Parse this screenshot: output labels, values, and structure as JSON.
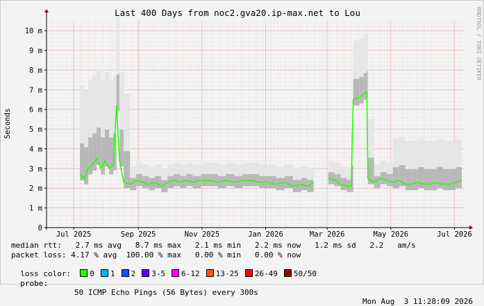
{
  "chart_data": {
    "type": "line",
    "title": "Last 400 Days from noc2.gva20.ip-max.net to Lou",
    "ylabel": "Seconds",
    "watermark": "RRDTOOL / TOBI OETIKER",
    "ylim": [
      0,
      0.0105
    ],
    "y_ticks": [
      "0",
      "1 m",
      "2 m",
      "3 m",
      "4 m",
      "5 m",
      "6 m",
      "7 m",
      "8 m",
      "9 m",
      "10 m"
    ],
    "y_tick_values": [
      0,
      0.001,
      0.002,
      0.003,
      0.004,
      0.005,
      0.006,
      0.007,
      0.008,
      0.009,
      0.01
    ],
    "x_ticks": [
      "Jul 2025",
      "Sep 2025",
      "Nov 2025",
      "Jan 2026",
      "Mar 2026",
      "May 2026",
      "Jul 2026"
    ],
    "x_tick_day": [
      26,
      88,
      149,
      210,
      269,
      330,
      391
    ],
    "xlim_days": [
      0,
      400
    ],
    "grid": true,
    "series": [
      {
        "name": "median rtt",
        "points": [
          [
            32,
            0.0027
          ],
          [
            36,
            0.0025
          ],
          [
            40,
            0.003
          ],
          [
            44,
            0.0032
          ],
          [
            48,
            0.0035
          ],
          [
            52,
            0.003
          ],
          [
            56,
            0.0034
          ],
          [
            60,
            0.003
          ],
          [
            64,
            0.0032
          ],
          [
            67,
            0.0062
          ],
          [
            70,
            0.0034
          ],
          [
            74,
            0.0023
          ],
          [
            80,
            0.0022
          ],
          [
            86,
            0.0024
          ],
          [
            92,
            0.0023
          ],
          [
            98,
            0.0022
          ],
          [
            104,
            0.0023
          ],
          [
            110,
            0.0021
          ],
          [
            116,
            0.0023
          ],
          [
            122,
            0.0024
          ],
          [
            128,
            0.0023
          ],
          [
            134,
            0.0024
          ],
          [
            140,
            0.0023
          ],
          [
            148,
            0.0024
          ],
          [
            156,
            0.0024
          ],
          [
            164,
            0.0023
          ],
          [
            172,
            0.0024
          ],
          [
            180,
            0.0023
          ],
          [
            188,
            0.0024
          ],
          [
            196,
            0.0024
          ],
          [
            204,
            0.0023
          ],
          [
            212,
            0.0023
          ],
          [
            220,
            0.0022
          ],
          [
            228,
            0.0023
          ],
          [
            236,
            0.0021
          ],
          [
            244,
            0.0022
          ],
          [
            250,
            0.0021
          ],
          [
            256,
            0.0023
          ]
        ]
      },
      {
        "name": "median rtt (after gap)",
        "points": [
          [
            270,
            0.0025
          ],
          [
            276,
            0.0024
          ],
          [
            282,
            0.0022
          ],
          [
            288,
            0.0021
          ],
          [
            292,
            0.0021
          ],
          [
            294,
            0.0065
          ],
          [
            300,
            0.0066
          ],
          [
            304,
            0.0068
          ],
          [
            307,
            0.0069
          ],
          [
            308,
            0.0025
          ],
          [
            314,
            0.0023
          ],
          [
            320,
            0.0025
          ],
          [
            326,
            0.0024
          ],
          [
            332,
            0.0023
          ],
          [
            338,
            0.0024
          ],
          [
            344,
            0.0022
          ],
          [
            350,
            0.0022
          ],
          [
            356,
            0.0023
          ],
          [
            362,
            0.0022
          ],
          [
            368,
            0.0022
          ],
          [
            374,
            0.0023
          ],
          [
            380,
            0.0022
          ],
          [
            386,
            0.0022
          ],
          [
            392,
            0.0023
          ],
          [
            398,
            0.0024
          ]
        ]
      }
    ]
  },
  "stats": {
    "median_rtt": "median rtt:   2.7 ms avg   8.7 ms max   2.1 ms min   2.2 ms now   1.2 ms sd   2.2   am/s",
    "packet_loss": "packet loss: 4.17 % avg  100.00 % max   0.00 % min   0.00 % now"
  },
  "loss_color": {
    "label": "loss color:",
    "items": [
      {
        "label": "0",
        "color": "#26ff00"
      },
      {
        "label": "1",
        "color": "#00b8ff"
      },
      {
        "label": "2",
        "color": "#0059ff"
      },
      {
        "label": "3-5",
        "color": "#5e00ff"
      },
      {
        "label": "6-12",
        "color": "#ff00ff"
      },
      {
        "label": "13-25",
        "color": "#ff5500"
      },
      {
        "label": "26-49",
        "color": "#ff0000"
      },
      {
        "label": "50/50",
        "color": "#a10000"
      }
    ]
  },
  "probe": {
    "label": "probe:",
    "text": "50 ICMP Echo Pings (56 Bytes) every 300s",
    "timestamp": "Mon Aug  3 11:28:09 2026"
  },
  "colors": {
    "median_line": "#26ff00",
    "axis": "#000000",
    "grid_minor": "#e0c8c8",
    "grid_major": "#e08080",
    "arrow": "#800000"
  }
}
